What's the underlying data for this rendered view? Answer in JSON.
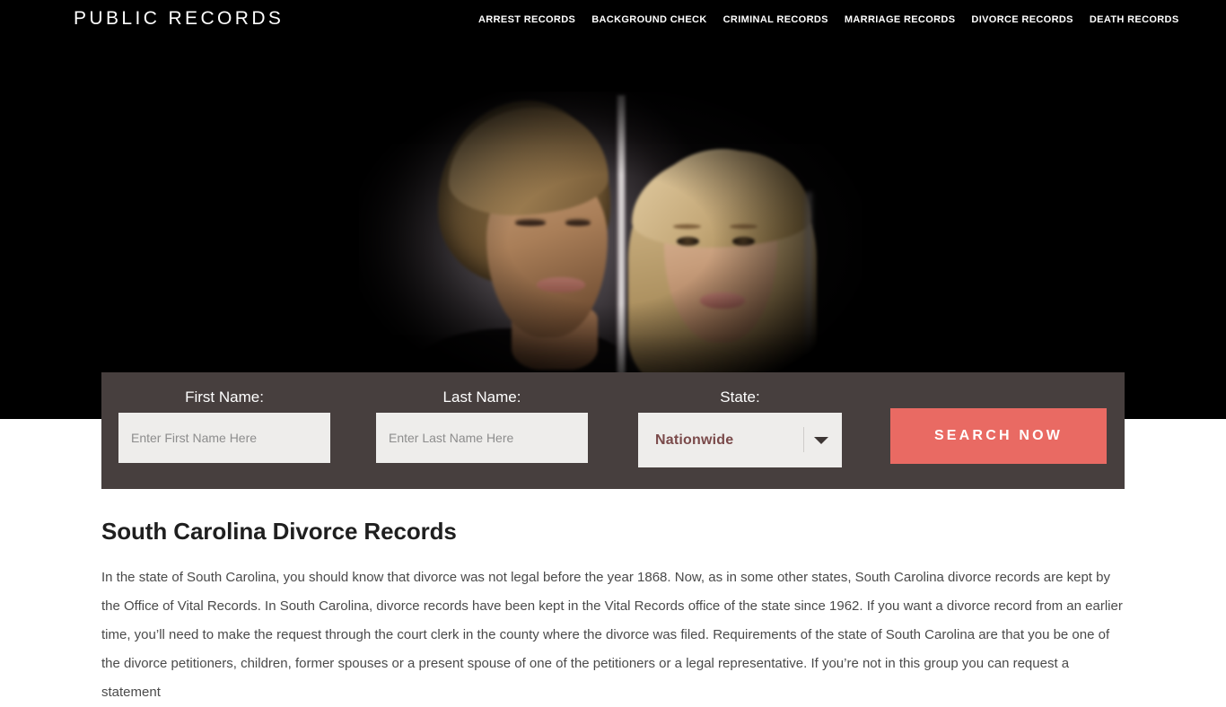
{
  "header": {
    "brand": "PUBLIC RECORDS",
    "nav": [
      {
        "label": "ARREST RECORDS",
        "name": "nav-arrest-records"
      },
      {
        "label": "BACKGROUND CHECK",
        "name": "nav-background-check"
      },
      {
        "label": "CRIMINAL RECORDS",
        "name": "nav-criminal-records"
      },
      {
        "label": "MARRIAGE RECORDS",
        "name": "nav-marriage-records"
      },
      {
        "label": "DIVORCE RECORDS",
        "name": "nav-divorce-records"
      },
      {
        "label": "DEATH RECORDS",
        "name": "nav-death-records"
      }
    ]
  },
  "hero": {
    "image_alt": "Couple separated by a wall, man on the left and woman on the right"
  },
  "search": {
    "first_name_label": "First Name:",
    "first_name_placeholder": "Enter First Name Here",
    "first_name_value": "",
    "last_name_label": "Last Name:",
    "last_name_placeholder": "Enter Last Name Here",
    "last_name_value": "",
    "state_label": "State:",
    "state_selected": "Nationwide",
    "submit_label": "SEARCH NOW",
    "accent_color": "#e96a63",
    "panel_color": "#473f3e",
    "input_color": "#eeedeb",
    "state_text_color": "#7a4a4a"
  },
  "article": {
    "title": "South Carolina Divorce Records",
    "paragraph": "In the state of South Carolina, you should know that divorce was not legal before the year 1868. Now, as in some other states, South Carolina divorce records are kept by the Office of Vital Records. In South Carolina, divorce records have been kept in the Vital Records office of the state since 1962. If you want a divorce record from an earlier time, you’ll need to make the request through the court clerk in the county where the divorce was filed. Requirements of the state of South Carolina are that you be one of the divorce petitioners, children, former spouses or a present spouse of one of the petitioners or a legal representative. If you’re not in this group you can request a statement"
  }
}
